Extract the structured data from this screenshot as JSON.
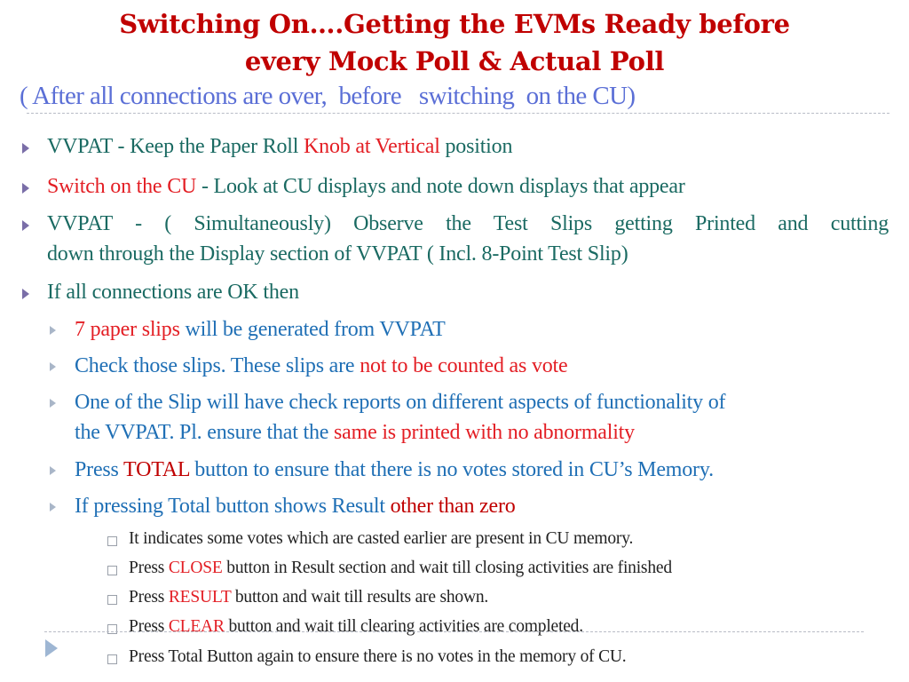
{
  "title": {
    "line1": "Switching On….Getting the EVMs Ready before",
    "line2": "every Mock Poll & Actual Poll",
    "subtitle": "( After all connections are over,  before   switching  on the CU)"
  },
  "bullets": [
    {
      "parts": [
        " VVPAT - Keep the Paper Roll ",
        "Knob at Vertical",
        " position"
      ]
    },
    {
      "parts": [
        "Switch on the CU",
        " - Look at CU displays and note down displays that appear"
      ]
    },
    {
      "line1": "VVPAT  -  ( Simultaneously)  Observe  the  Test  Slips  getting  Printed  and  cutting",
      "line2": "down through the Display section of VVPAT ( Incl. 8-Point Test Slip)"
    },
    {
      "text": "If all connections are OK then"
    }
  ],
  "sub_bullets": [
    {
      "parts": [
        "7 paper slips",
        " will be generated from VVPAT"
      ]
    },
    {
      "parts": [
        "Check those slips. These slips are ",
        "not to be counted as vote"
      ]
    },
    {
      "line1": "One of the Slip will have check reports on different aspects of functionality of",
      "line2_parts": [
        "the VVPAT. Pl. ensure that the ",
        "same is printed with no abnormality"
      ]
    },
    {
      "parts": [
        "Press ",
        "TOTAL",
        " button to ensure that there is no votes stored in CU’s Memory."
      ]
    },
    {
      "parts": [
        "If  pressing Total button shows Result ",
        "other than zero"
      ]
    }
  ],
  "sub_sub_bullets": [
    {
      "parts": [
        "It indicates some votes which are casted earlier are present in CU memory."
      ]
    },
    {
      "parts": [
        "Press ",
        "CLOSE",
        " button in Result section and wait till closing activities are finished"
      ]
    },
    {
      "parts": [
        "Press ",
        "RESULT",
        " button and wait till results are shown."
      ]
    },
    {
      "parts": [
        "Press ",
        "CLEAR",
        " button and wait till clearing activities are completed."
      ]
    },
    {
      "parts": [
        "Press Total Button again to ensure there is no votes in the memory of CU."
      ]
    }
  ],
  "colors": {
    "title": "#c00000",
    "subtitle": "#5b6fd6",
    "level1_text": "#1a6a62",
    "level2_text": "#1f6fb5",
    "highlight_red": "#e31e24",
    "level3_text": "#222222"
  }
}
